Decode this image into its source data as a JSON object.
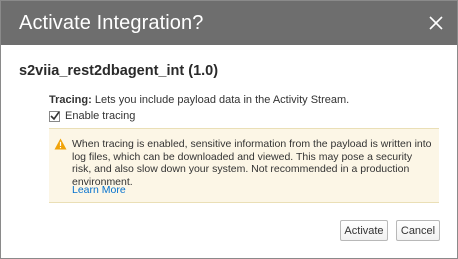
{
  "dialog": {
    "title": "Activate Integration?",
    "integration_name": "s2viia_rest2dbagent_int (1.0)",
    "tracing_label": "Tracing:",
    "tracing_description": " Lets you include payload data in the Activity Stream.",
    "enable_tracing_label": "Enable tracing",
    "enable_tracing_checked": true,
    "warning_message": "When tracing is enabled, sensitive information from the payload is written into log files, which can be downloaded and viewed. This may pose a security risk, and also slow down your system. Not recommended in a production environment.",
    "learn_more_label": "Learn More",
    "activate_label": "Activate",
    "cancel_label": "Cancel"
  },
  "icons": {
    "close": "close-icon",
    "warning": "warning-icon",
    "checkmark": "checkmark-icon"
  },
  "colors": {
    "header_bg": "#6e6e6e",
    "warning_bg": "#fcf6e6",
    "warning_icon": "#f0a30a",
    "link": "#0572ce"
  }
}
